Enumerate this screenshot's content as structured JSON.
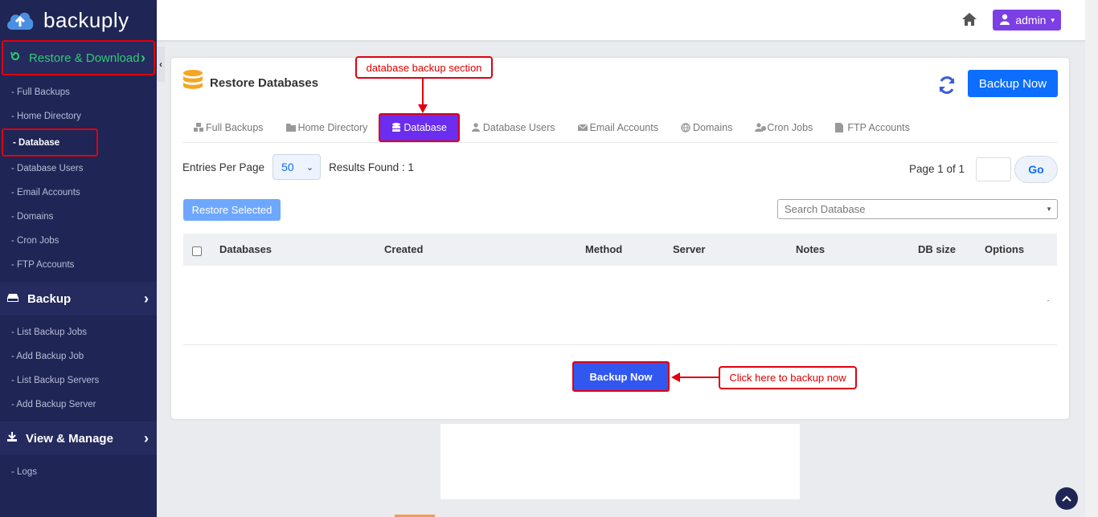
{
  "app": {
    "name": "backuply"
  },
  "sidebar": {
    "sections": [
      {
        "label": "Restore & Download",
        "icon": "restore-icon",
        "active": true,
        "items": [
          "- Full Backups",
          "- Home Directory",
          "- Database",
          "- Database Users",
          "- Email Accounts",
          "- Domains",
          "- Cron Jobs",
          "- FTP Accounts"
        ]
      },
      {
        "label": "Backup",
        "icon": "drive-icon",
        "items": [
          "- List Backup Jobs",
          "- Add Backup Job",
          "- List Backup Servers",
          "- Add Backup Server"
        ]
      },
      {
        "label": "View & Manage",
        "icon": "download-icon",
        "items": [
          "- Logs"
        ]
      }
    ],
    "collapse_glyph": "‹"
  },
  "topbar": {
    "user": "admin"
  },
  "card": {
    "title": "Restore Databases",
    "backup_now": "Backup Now",
    "tabs": [
      "Full Backups",
      "Home Directory",
      "Database",
      "Database Users",
      "Email Accounts",
      "Domains",
      "Cron Jobs",
      "FTP Accounts"
    ],
    "entries_label": "Entries Per Page",
    "entries_value": "50",
    "results": "Results Found : 1",
    "page_info": "Page 1 of 1",
    "go": "Go",
    "restore_selected": "Restore Selected",
    "search_placeholder": "Search Database",
    "columns": [
      "Databases",
      "Created",
      "Method",
      "Server",
      "Notes",
      "DB size",
      "Options"
    ],
    "backup_now_bottom": "Backup Now"
  },
  "annotations": {
    "top": "database backup section",
    "right": "Click here to backup now"
  },
  "colors": {
    "sidebar": "#1f2554",
    "active_green": "#2ecc71",
    "annotation_red": "#e0000f",
    "primary": "#0d6efd",
    "tab_active": "#6b2df0"
  }
}
